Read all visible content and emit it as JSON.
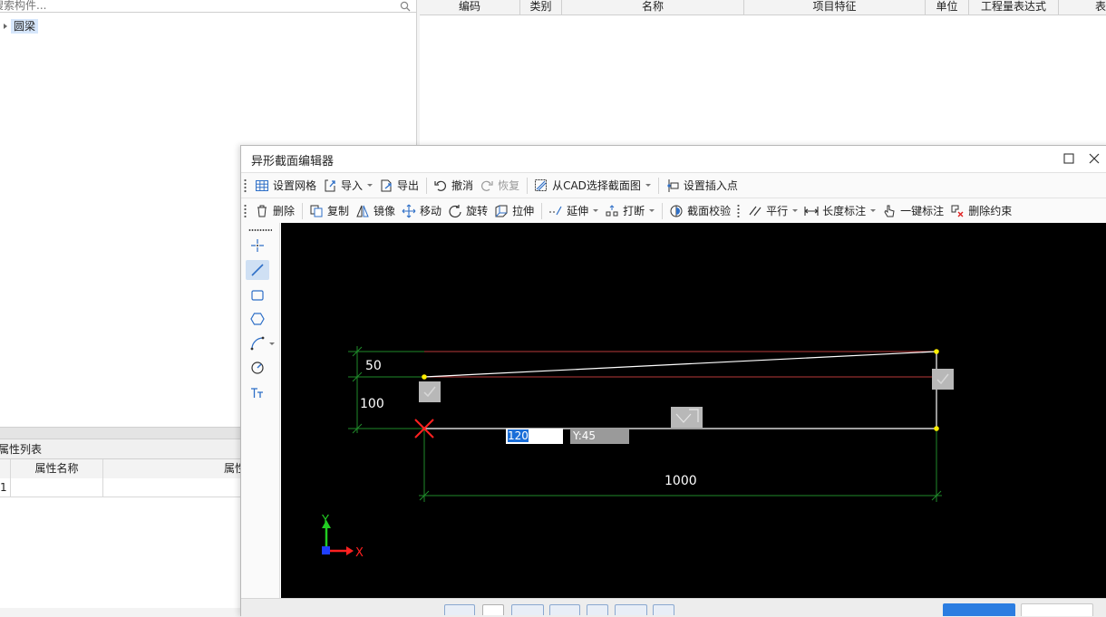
{
  "left": {
    "search_placeholder": "搜索构件...",
    "tree_root_label": "圆梁",
    "property_list_title": "属性列表",
    "property_columns": [
      "属性名称",
      "属性值"
    ],
    "property_rows": [
      {
        "index": "1",
        "name": "",
        "value": ""
      }
    ]
  },
  "grid": {
    "columns": [
      "编码",
      "类别",
      "名称",
      "项目特征",
      "单位",
      "工程量表达式",
      "表"
    ]
  },
  "dialog": {
    "title": "异形截面编辑器",
    "toolbar1": {
      "grid_label": "设置网格",
      "import_label": "导入",
      "export_label": "导出",
      "undo_label": "撤消",
      "redo_label": "恢复",
      "cad_label": "从CAD选择截面图",
      "insert_point_label": "设置插入点"
    },
    "toolbar2": {
      "delete_label": "删除",
      "copy_label": "复制",
      "mirror_label": "镜像",
      "move_label": "移动",
      "rotate_label": "旋转",
      "stretch_label": "拉伸",
      "extend_label": "延伸",
      "break_label": "打断",
      "check_label": "截面校验",
      "parallel_label": "平行",
      "length_dim_label": "长度标注",
      "auto_dim_label": "一键标注",
      "remove_constraint_label": "删除约束"
    },
    "canvas": {
      "dim_top": "50",
      "dim_left": "100",
      "dim_bottom": "1000",
      "coord_x_value": "120",
      "coord_y_value": "Y:45",
      "axis_x_label": "X",
      "axis_y_label": "Y"
    },
    "colors": {
      "canvas_bg": "#000000",
      "dimension_line": "#1f8a2a",
      "shape_line": "#ffffff",
      "guide_line": "#b83a3a",
      "vertex": "#ffee00",
      "origin_marker": "#ff2020",
      "axis_x": "#ff2020",
      "axis_y": "#22cc22"
    }
  }
}
